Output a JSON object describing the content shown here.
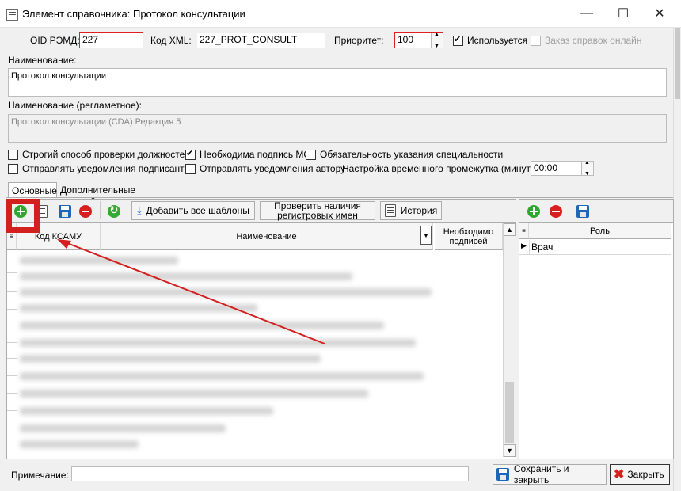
{
  "window": {
    "title": "Элемент справочника: Протокол консультации",
    "minimize": "—",
    "maximize": "☐",
    "close": "✕"
  },
  "form": {
    "oid_label": "OID РЭМД:",
    "oid_value": "227",
    "xml_label": "Код XML:",
    "xml_value": "227_PROT_CONSULT",
    "priority_label": "Приоритет:",
    "priority_value": "100",
    "used_label": "Используется",
    "used_checked": true,
    "online_label": "Заказ справок онлайн",
    "name_label": "Наименование:",
    "name_value": "Протокол консультации",
    "reg_name_label": "Наименование (регламетное):",
    "reg_name_value": "Протокол консультации (CDA) Редакция 5"
  },
  "options": {
    "strict_check": "Строгий способ проверки должностей",
    "need_mo_sign": "Необходима подпись МО",
    "require_specialty": "Обязательность указания специальности",
    "notify_signers": "Отправлять уведомления подписантов",
    "notify_author": "Отправлять уведомления автору",
    "time_setting_label": "Настройка временного промежутка (минуты):",
    "time_setting_value": "00:00"
  },
  "tabs": [
    {
      "label": "Основные",
      "active": true
    },
    {
      "label": "Дополнительные настройки",
      "active": false
    }
  ],
  "toolbar": {
    "add_all_templates": "Добавить все шаблоны",
    "check_registry_line1": "Проверить наличия",
    "check_registry_line2": "регистровых имен",
    "history": "История"
  },
  "grid": {
    "columns": [
      "Код КСАМУ",
      "Наименование",
      "Необходимо подписей"
    ]
  },
  "roles": {
    "column": "Роль",
    "rows": [
      "Врач"
    ]
  },
  "footer": {
    "note_label": "Примечание:",
    "note_value": "",
    "save_close": "Сохранить и закрыть",
    "close": "Закрыть"
  },
  "colors": {
    "highlight": "#d41f1f",
    "add_green": "#2ea82e",
    "remove_red": "#d82020",
    "save_blue": "#1f67b5"
  }
}
